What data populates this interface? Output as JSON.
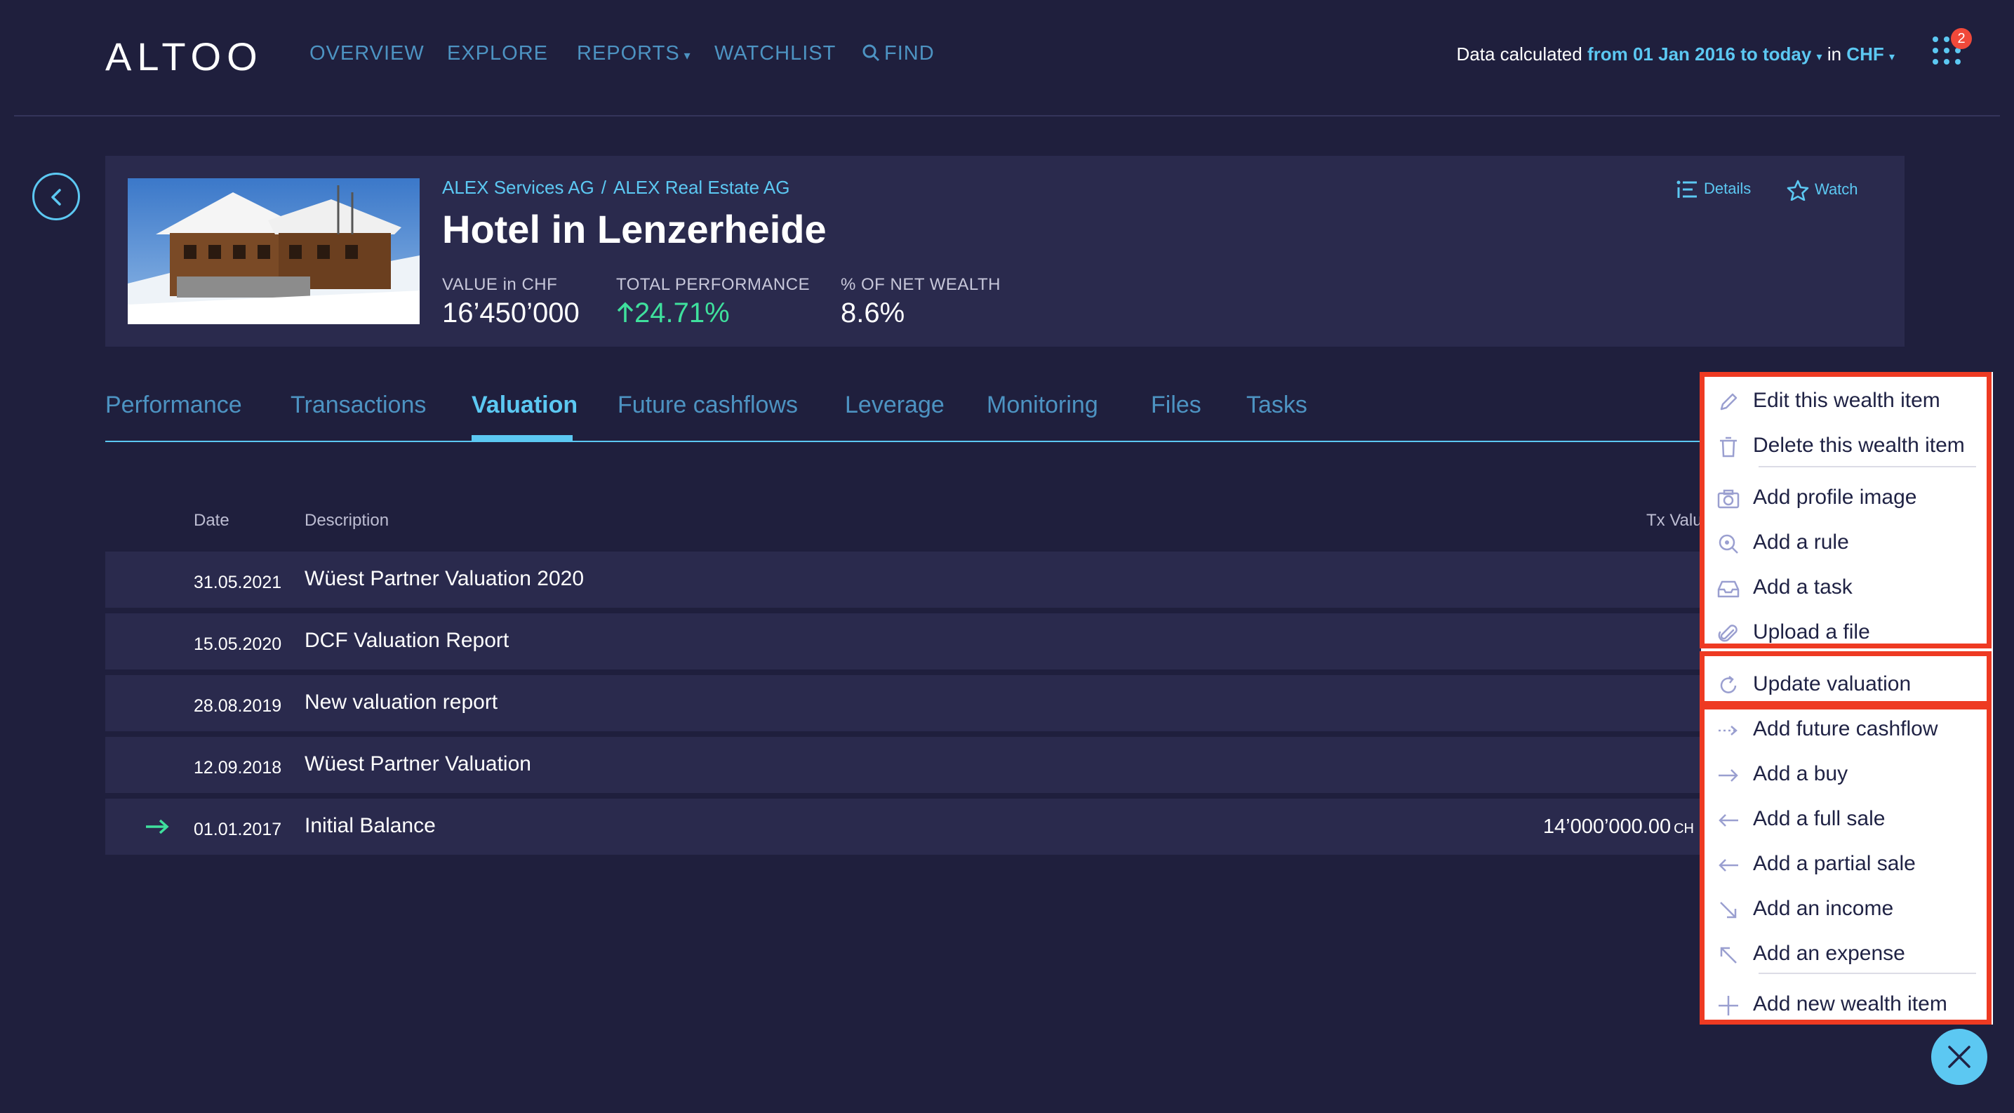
{
  "nav": {
    "logo": "ALTOO",
    "items": [
      "OVERVIEW",
      "EXPLORE",
      "REPORTS",
      "WATCHLIST",
      "FIND"
    ],
    "calc_prefix": "Data calculated",
    "calc_range": "from 01 Jan 2016 to today",
    "calc_in": "in",
    "calc_currency": "CHF",
    "notification_count": "2"
  },
  "asset": {
    "breadcrumb": [
      "ALEX Services AG",
      "ALEX Real Estate AG"
    ],
    "breadcrumb_sep": "/",
    "title": "Hotel in Lenzerheide",
    "kpis": [
      {
        "label": "VALUE in CHF",
        "value": "16’450’000"
      },
      {
        "label": "TOTAL PERFORMANCE",
        "value": "24.71%"
      },
      {
        "label": "% OF NET WEALTH",
        "value": "8.6%"
      }
    ],
    "actions": {
      "details": "Details",
      "watch": "Watch"
    }
  },
  "tabs": [
    "Performance",
    "Transactions",
    "Valuation",
    "Future cashflows",
    "Leverage",
    "Monitoring",
    "Files",
    "Tasks"
  ],
  "active_tab": "Valuation",
  "table": {
    "headers": {
      "date": "Date",
      "description": "Description",
      "tx_value": "Tx Valu"
    },
    "rows": [
      {
        "date": "31.05.2021",
        "description": "Wüest Partner Valuation 2020",
        "value": "",
        "currency": ""
      },
      {
        "date": "15.05.2020",
        "description": "DCF Valuation Report",
        "value": "",
        "currency": ""
      },
      {
        "date": "28.08.2019",
        "description": "New valuation report",
        "value": "",
        "currency": ""
      },
      {
        "date": "12.09.2018",
        "description": "Wüest Partner Valuation",
        "value": "",
        "currency": ""
      },
      {
        "date": "01.01.2017",
        "description": "Initial Balance",
        "value": "14’000’000.00",
        "currency": "CH"
      }
    ]
  },
  "menu": {
    "items": [
      {
        "label": "Edit this wealth item",
        "icon": "pencil-icon"
      },
      {
        "label": "Delete this wealth item",
        "icon": "trash-icon"
      },
      {
        "label": "Add profile image",
        "icon": "camera-icon"
      },
      {
        "label": "Add a rule",
        "icon": "rule-search-icon"
      },
      {
        "label": "Add a task",
        "icon": "inbox-icon"
      },
      {
        "label": "Upload a file",
        "icon": "paperclip-icon"
      },
      {
        "label": "Update valuation",
        "icon": "refresh-icon"
      },
      {
        "label": "Add future cashflow",
        "icon": "dotted-arrow-right-icon"
      },
      {
        "label": "Add a buy",
        "icon": "arrow-right-icon"
      },
      {
        "label": "Add a full sale",
        "icon": "arrow-left-icon"
      },
      {
        "label": "Add a partial sale",
        "icon": "arrow-left-icon"
      },
      {
        "label": "Add an income",
        "icon": "arrow-down-right-icon"
      },
      {
        "label": "Add an expense",
        "icon": "arrow-up-left-icon"
      },
      {
        "label": "Add new wealth item",
        "icon": "plus-icon"
      }
    ]
  },
  "colors": {
    "background": "#1f1f3d",
    "card": "#2a2a4d",
    "accent": "#5cc8f2",
    "positive": "#3fe09d",
    "highlight_box": "#ee3a22",
    "badge": "#f0493a"
  }
}
